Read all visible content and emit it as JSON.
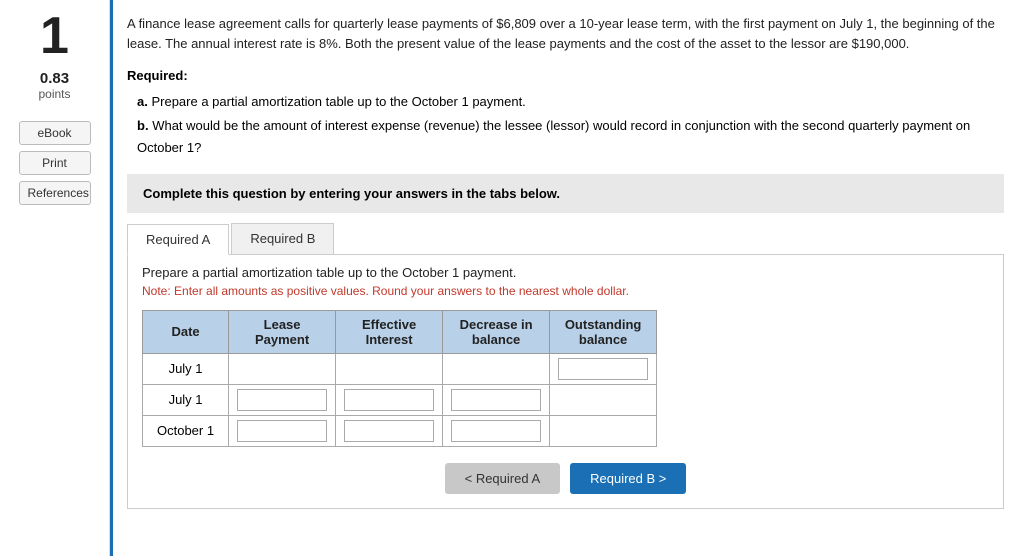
{
  "sidebar": {
    "question_number": "1",
    "points_value": "0.83",
    "points_label": "points",
    "buttons": [
      {
        "id": "ebook",
        "label": "eBook"
      },
      {
        "id": "print",
        "label": "Print"
      },
      {
        "id": "references",
        "label": "References"
      }
    ]
  },
  "question": {
    "text": "A finance lease agreement calls for quarterly lease payments of $6,809 over a 10-year lease term, with the first payment on July 1, the beginning of the lease. The annual interest rate is 8%. Both the present value of the lease payments and the cost of the asset to the lessor are $190,000.",
    "required_label": "Required:",
    "items": [
      {
        "key": "a",
        "text": "Prepare a partial amortization table up to the October 1 payment."
      },
      {
        "key": "b",
        "text": "What would be the amount of interest expense (revenue) the lessee (lessor) would record in conjunction with the second quarterly payment on October 1?"
      }
    ]
  },
  "complete_box": {
    "text": "Complete this question by entering your answers in the tabs below."
  },
  "tabs": [
    {
      "id": "required-a",
      "label": "Required A",
      "active": true
    },
    {
      "id": "required-b",
      "label": "Required B",
      "active": false
    }
  ],
  "tab_a": {
    "description": "Prepare a partial amortization table up to the October 1 payment.",
    "note": "Note: Enter all amounts as positive values. Round your answers to the nearest whole dollar.",
    "table": {
      "headers": [
        "Date",
        "Lease\nPayment",
        "Effective\nInterest",
        "Decrease in\nbalance",
        "Outstanding\nbalance"
      ],
      "rows": [
        {
          "date": "July 1",
          "lease_payment": "",
          "effective_interest": "",
          "decrease_in_balance": "",
          "outstanding_balance": "",
          "has_inputs": false
        },
        {
          "date": "July 1",
          "lease_payment": "",
          "effective_interest": "",
          "decrease_in_balance": "",
          "outstanding_balance": "",
          "has_inputs": true
        },
        {
          "date": "October 1",
          "lease_payment": "",
          "effective_interest": "",
          "decrease_in_balance": "",
          "outstanding_balance": "",
          "has_inputs": true
        }
      ]
    }
  },
  "nav": {
    "prev_label": "< Required A",
    "next_label": "Required B >"
  }
}
